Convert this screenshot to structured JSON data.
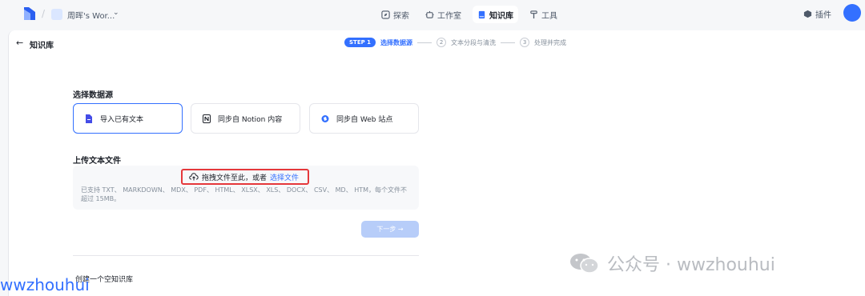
{
  "topbar": {
    "workspace_name": "周晖's Wor...",
    "nav": [
      {
        "label": "探索",
        "icon": "compass-icon",
        "active": false
      },
      {
        "label": "工作室",
        "icon": "robot-icon",
        "active": false
      },
      {
        "label": "知识库",
        "icon": "book-icon",
        "active": true
      },
      {
        "label": "工具",
        "icon": "hammer-icon",
        "active": false
      }
    ],
    "plugins_label": "插件"
  },
  "header": {
    "title": "知识库",
    "steps": {
      "badge": "STEP 1",
      "current": "选择数据源",
      "step2_num": "2",
      "step2": "文本分段与清洗",
      "step3_num": "3",
      "step3": "处理并完成"
    }
  },
  "datasource": {
    "title": "选择数据源",
    "options": [
      {
        "label": "导入已有文本",
        "icon": "file-icon"
      },
      {
        "label": "同步自 Notion 内容",
        "icon": "notion-icon"
      },
      {
        "label": "同步自 Web 站点",
        "icon": "web-icon"
      }
    ]
  },
  "upload": {
    "title": "上传文本文件",
    "drag_text": "拖拽文件至此，或者",
    "select_link": "选择文件",
    "hint": "已支持 TXT、 MARKDOWN、 MDX、 PDF、 HTML、 XLSX、 XLS、 DOCX、 CSV、 MD、 HTM，每个文件不超过 15MB。"
  },
  "actions": {
    "next_label": "下一步 →",
    "create_empty_label": "创建一个空知识库"
  },
  "watermarks": {
    "left": "wwzhouhui",
    "right": "公众号 · wwzhouhui"
  },
  "colors": {
    "accent": "#3370ff",
    "highlight_border": "#e5383b"
  }
}
